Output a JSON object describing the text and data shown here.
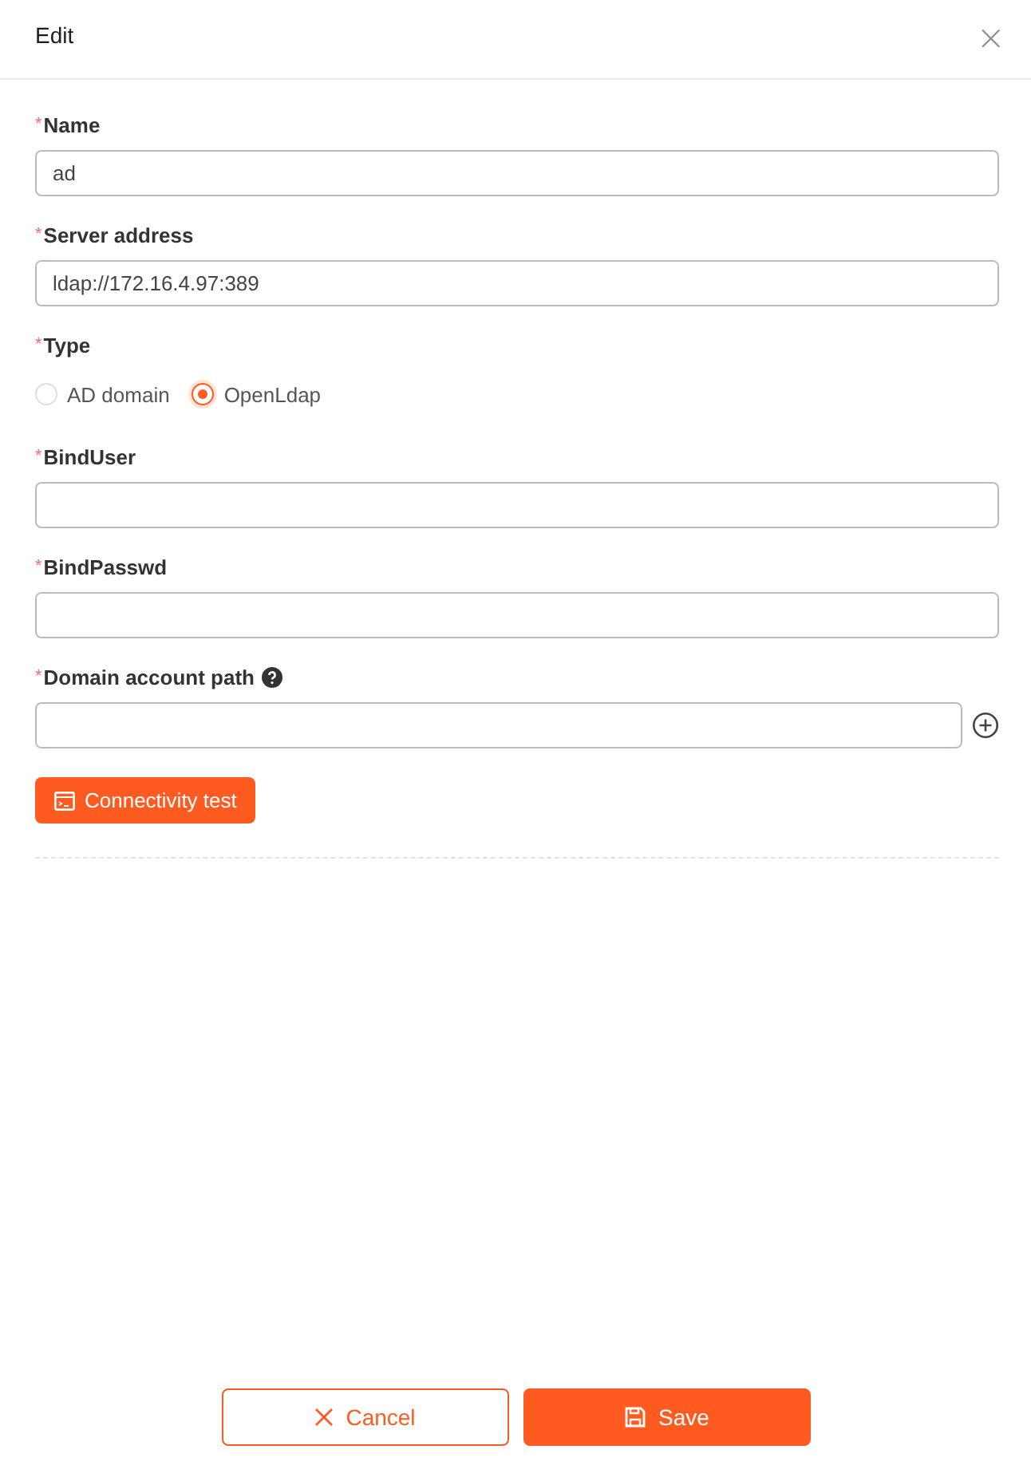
{
  "dialog": {
    "title": "Edit",
    "close_icon": "×"
  },
  "fields": [
    {
      "kind": "text",
      "required_mark": "*",
      "label": "Name",
      "value": "ad"
    },
    {
      "kind": "text",
      "required_mark": "*",
      "label": "Server address",
      "value": "ldap://172.16.4.97:389"
    },
    {
      "kind": "radio",
      "required_mark": "*",
      "label": "Type",
      "options": [
        {
          "label": "AD domain",
          "selected": false
        },
        {
          "label": "OpenLdap",
          "selected": true
        }
      ]
    },
    {
      "kind": "text",
      "required_mark": "*",
      "label": "BindUser"
    },
    {
      "kind": "text",
      "required_mark": "*",
      "label": "BindPasswd"
    },
    {
      "kind": "path",
      "required_mark": "*",
      "label": "Domain account path",
      "help": true
    }
  ],
  "test_button": "Connectivity test",
  "footer": {
    "cancel": "Cancel",
    "save": "Save"
  }
}
